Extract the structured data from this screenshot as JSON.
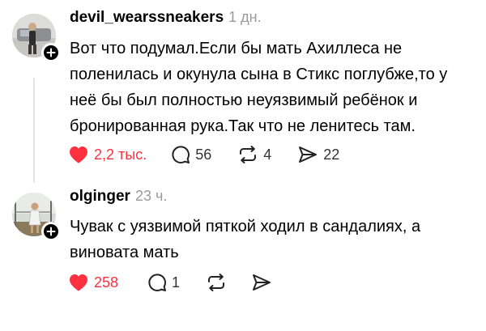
{
  "posts": [
    {
      "username": "devil_wearssneakers",
      "time": "1 дн.",
      "text": "Вот что подумал.Если бы мать Ахиллеса не поленилась и окунула сына в Стикс поглубже,то у неё бы был полностью неуязвимый ребёнок и бронированная рука.Так что не ленитесь там.",
      "likes": "2,2 тыс.",
      "comments": "56",
      "reposts": "4",
      "shares": "22",
      "liked": true
    },
    {
      "username": "olginger",
      "time": "23 ч.",
      "text": "Чувак с уязвимой пяткой ходил в сандалиях, а виновата мать",
      "likes": "258",
      "comments": "1",
      "reposts": "",
      "shares": "",
      "liked": true
    }
  ],
  "icons": {
    "like": "heart-filled-icon",
    "comment": "speech-bubble-icon",
    "repost": "repost-arrows-icon",
    "share": "paper-plane-icon",
    "follow": "plus-icon"
  },
  "colors": {
    "like_active": "#ff3040",
    "secondary_text": "#9a9a9a",
    "thread_line": "#e3e3e3"
  }
}
